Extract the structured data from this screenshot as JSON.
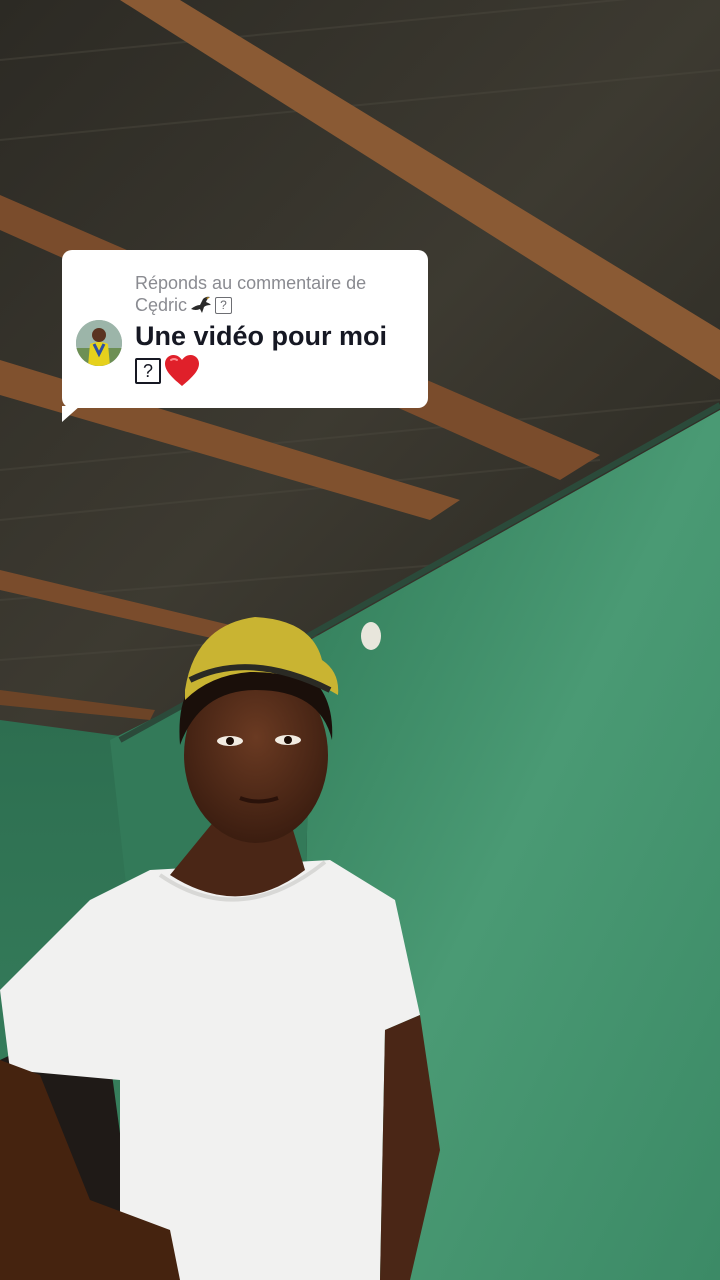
{
  "reply_bubble": {
    "header_line1": "Réponds au commentaire de",
    "commenter_name": "Cędric",
    "commenter_emoji_icon": "eagle-icon",
    "unknown_glyph": "?",
    "comment_text": "Une vidéo pour moi",
    "comment_glyph": "?",
    "comment_emoji_icon": "red-heart-icon"
  },
  "colors": {
    "bubble_bg": "#ffffff",
    "header_text": "#8a8b91",
    "comment_text": "#161823",
    "heart": "#e0202a",
    "wall_green": "#3f8f6a"
  }
}
